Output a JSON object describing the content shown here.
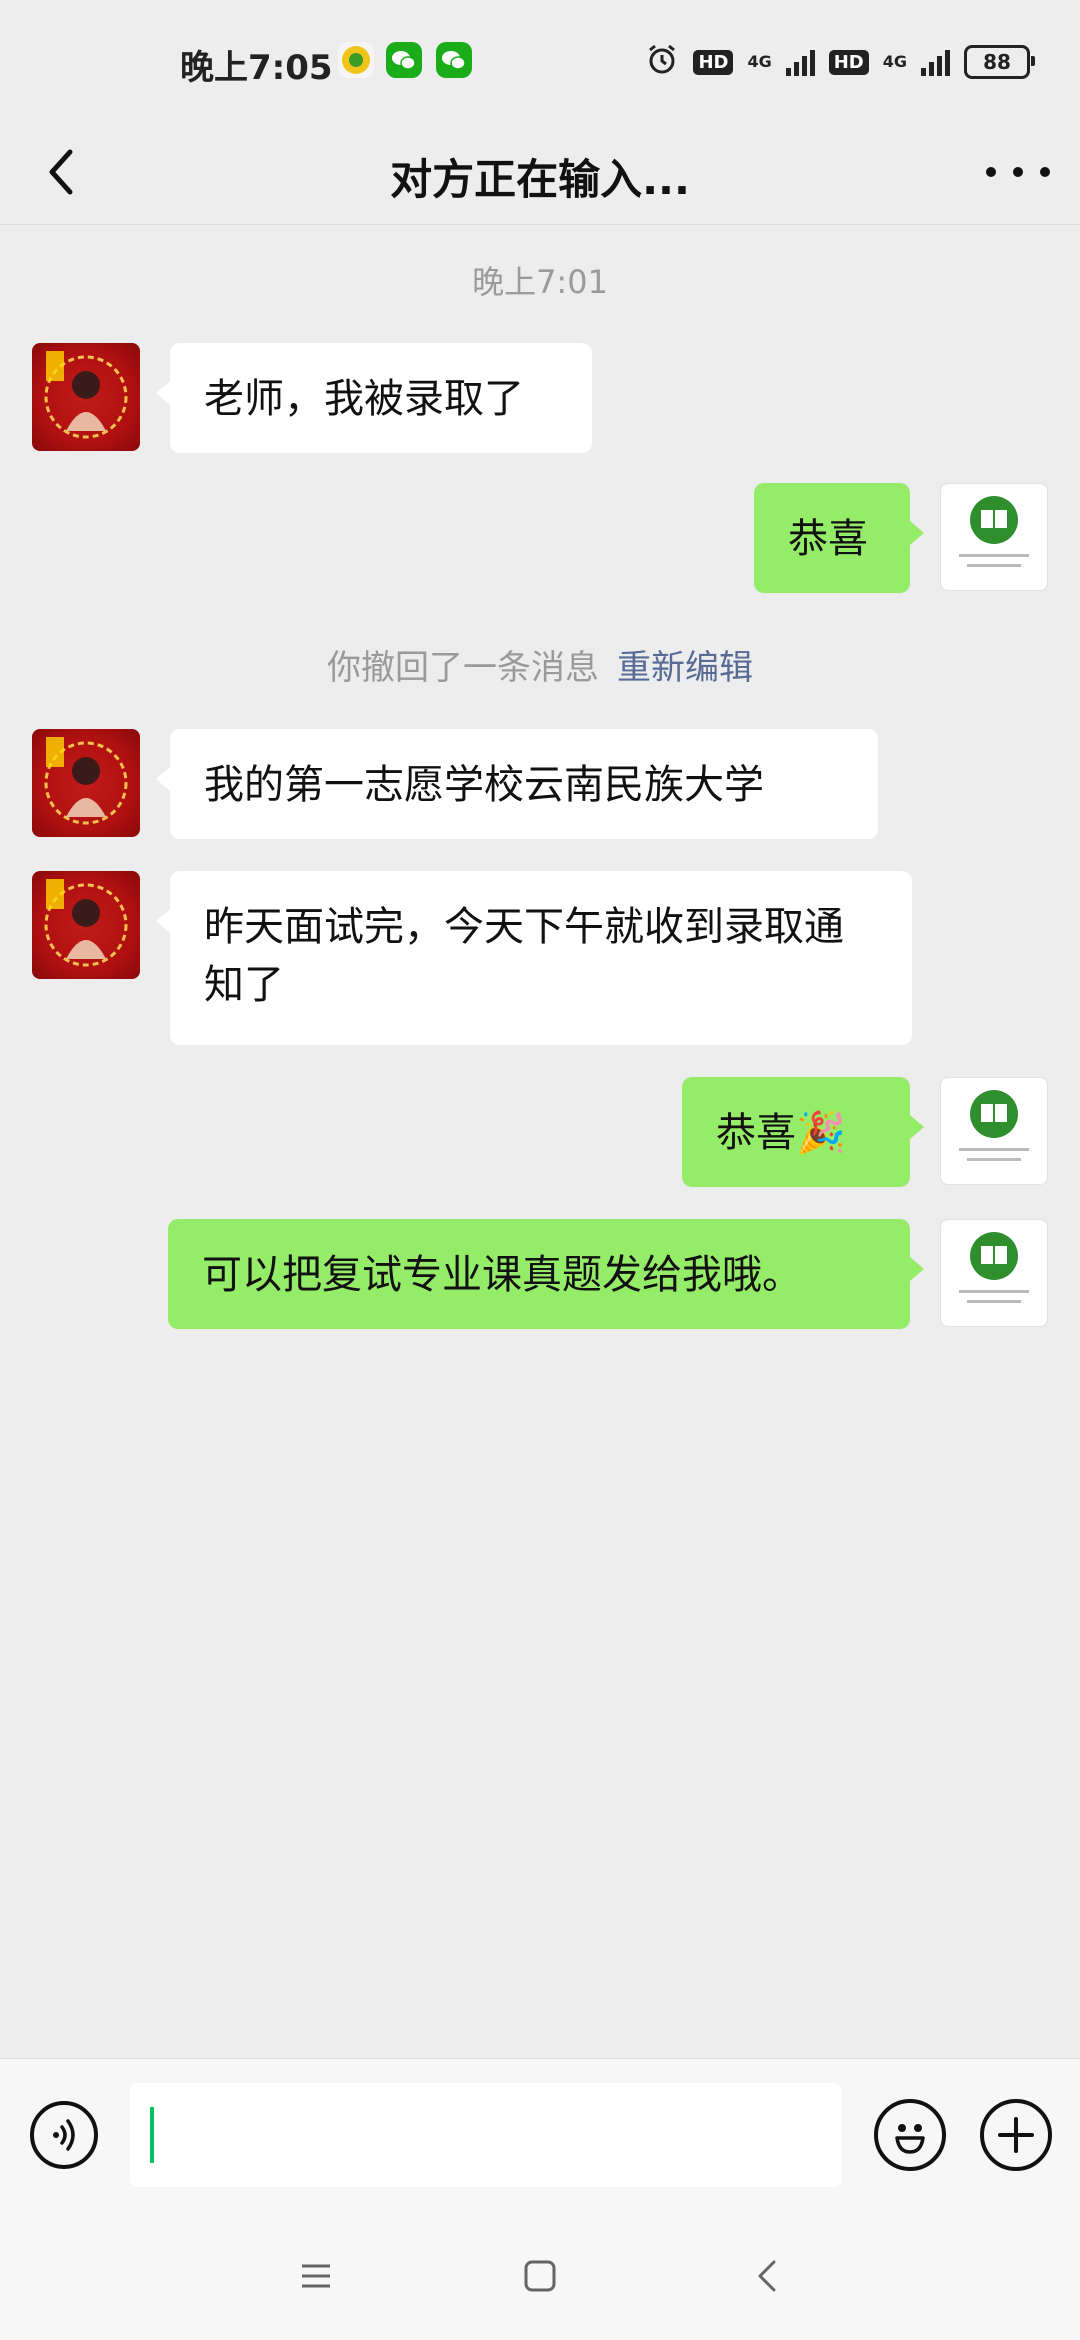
{
  "status_bar": {
    "time": "晚上7:05",
    "hd1": "HD",
    "net1": "4G",
    "hd2": "HD",
    "net2": "4G",
    "battery": "88"
  },
  "header": {
    "title": "对方正在输入..."
  },
  "chat": {
    "timestamp": "晚上7:01",
    "recall_text": "你撤回了一条消息",
    "recall_action": "重新编辑",
    "messages": [
      {
        "side": "in",
        "text": "老师，我被录取了"
      },
      {
        "side": "out",
        "text": "恭喜"
      },
      {
        "side": "in",
        "text": "我的第一志愿学校云南民族大学"
      },
      {
        "side": "in",
        "text": "昨天面试完，今天下午就收到录取通知了"
      },
      {
        "side": "out",
        "text": "恭喜🎉"
      },
      {
        "side": "out",
        "text": "可以把复试专业课真题发给我哦。"
      }
    ]
  },
  "input": {
    "value": ""
  },
  "colors": {
    "bubble_out": "#95ec69",
    "bubble_in": "#ffffff",
    "background": "#ededed",
    "link": "#576b95",
    "caret": "#07c160"
  },
  "icons": {
    "back": "chevron-left-icon",
    "more": "more-icon",
    "voice": "voice-icon",
    "emoji": "emoji-icon",
    "plus": "plus-icon"
  }
}
